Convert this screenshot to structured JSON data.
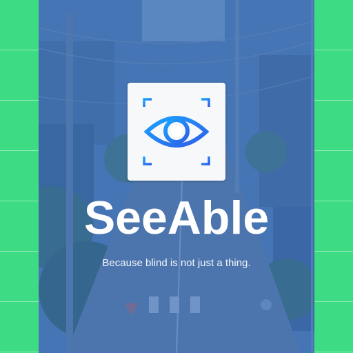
{
  "splash": {
    "app_name": "SeeAble",
    "tagline": "Because blind is not just a thing.",
    "logo_icon": "eye-scan-icon",
    "background_image": "street-photo"
  },
  "colors": {
    "outer_background": "#3ddc84",
    "overlay_tint": "#346ebe",
    "logo_card": "#f7f8fa",
    "logo_gradient_start": "#1a9cff",
    "logo_gradient_end": "#2f5fe8",
    "text": "#ffffff"
  }
}
